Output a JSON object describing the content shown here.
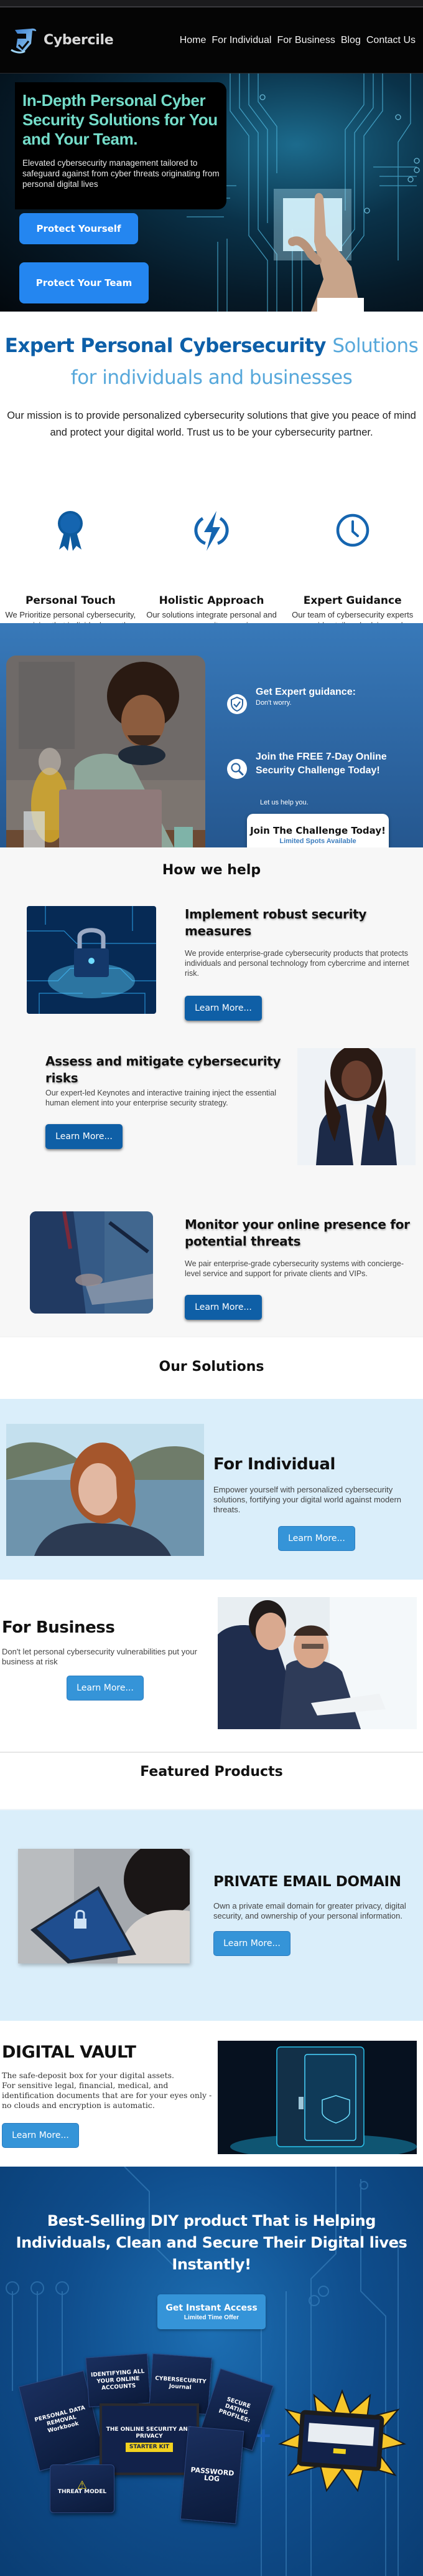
{
  "nav": {
    "brand": "Cybercile",
    "links": [
      "Home",
      "For Individual",
      "For Business",
      "Blog",
      "Contact Us"
    ]
  },
  "hero": {
    "title": "In-Depth Personal Cyber Security Solutions for You and Your Team.",
    "subtitle": "Elevated cybersecurity management tailored to safeguard against from cyber threats originating from personal digital lives",
    "buttons": [
      "Protect Yourself",
      "Protect Your Team"
    ]
  },
  "expert": {
    "title_dark": "Expert Personal Cybersecurity",
    "title_light": "Solutions for individuals and businesses",
    "mission": "Our mission is to provide personalized cybersecurity solutions that give you peace of mind and protect your digital world. Trust us to be your cybersecurity partner.",
    "features": [
      {
        "icon": "award-ribbon-icon",
        "title": "Personal Touch",
        "text": "We Prioritize personal cybersecurity, recognizing that individuals are the weakest link in a company's security chain"
      },
      {
        "icon": "lightning-bolt-icon",
        "title": "Holistic Approach",
        "text": "Our solutions integrate personal and company security, ensuring a comprehensive defense strategy"
      },
      {
        "icon": "clock-icon",
        "title": "Expert Guidance",
        "text": "Our team of cybersecurity experts provides tailored advice and support, helping you navigate the complex security landscape"
      }
    ]
  },
  "challenge": {
    "item1_title": "Get Expert guidance:",
    "item1_sub": "Don't worry.",
    "item2_title": "Join the FREE 7-Day Online Security Challenge Today!",
    "help_text": "Let us help you.",
    "button_main": "Join The Challenge Today!",
    "button_sub": "Limited Spots Available"
  },
  "how_we_help": {
    "title": "How we help",
    "items": [
      {
        "title": "Implement robust security measures",
        "text": "We provide enterprise-grade cybersecurity products that protects individuals and personal technology from cybercrime and internet risk.",
        "button": "Learn More..."
      },
      {
        "title": "Assess and mitigate cybersecurity risks",
        "text": "Our expert-led Keynotes and interactive training inject the essential human element into your enterprise security strategy.",
        "button": "Learn More..."
      },
      {
        "title": "Monitor your online presence for potential threats",
        "text": "We pair enterprise-grade cybersecurity systems with concierge-level service and support for private clients and VIPs.",
        "button": "Learn More..."
      }
    ]
  },
  "solutions": {
    "title": "Our Solutions",
    "individual": {
      "title": "For Individual",
      "text": "Empower yourself with personalized cybersecurity solutions, fortifying your digital world against modern threats.",
      "button": "Learn More..."
    },
    "business": {
      "title": "For Business",
      "text": "Don't let personal cybersecurity vulnerabilities put your business at risk",
      "button": "Learn More..."
    }
  },
  "featured": {
    "title": "Featured Products",
    "email": {
      "title": "PRIVATE EMAIL DOMAIN",
      "text": "Own a private email domain for greater privacy, digital security, and ownership of your personal information.",
      "button": "Learn More..."
    },
    "vault": {
      "title": "DIGITAL VAULT",
      "line1": "The safe-deposit box for your digital assets.",
      "line2": "For sensitive legal, financial, medical, and identification documents that are for your eyes only - no clouds and encryption is automatic.",
      "button": "Learn More..."
    }
  },
  "cta": {
    "title": "Best-Selling DIY product That is Helping Individuals, Clean and Secure Their Digital lives Instantly!",
    "button_main": "Get Instant Access",
    "button_sub": "Limited Time Offer",
    "products": [
      "PERSONAL DATA REMOVAL Workbook",
      "IDENTIFYING ALL YOUR ONLINE ACCOUNTS",
      "CYBERSECURITY Journal",
      "SECURE DATING PROFILES:",
      "THE ONLINE SECURITY AND PRIVACY",
      "STARTER KIT",
      "PASSWORD LOG",
      "THREAT MODEL"
    ]
  },
  "colors": {
    "hero_title": "#74dcc9",
    "primary_button": "#2486f0",
    "dark_blue": "#0f5fa6",
    "light_blue": "#3594d8",
    "light_bg": "#daeefa"
  }
}
